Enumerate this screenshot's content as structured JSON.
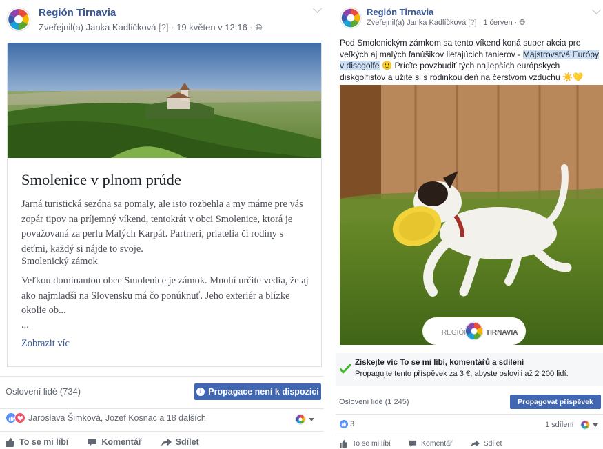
{
  "post1": {
    "page_name": "Región Tirnavia",
    "meta": {
      "author": "Zveřejnil(a) Janka Kadlíčková",
      "qmark": "[?]",
      "date": "· 19 květen v 12:16 ·"
    },
    "card": {
      "title": "Smolenice v plnom prúde",
      "paragraph1": "Jarná turistická sezóna sa pomaly, ale isto rozbehla a my máme pre vás zopár tipov na príjemný víkend, tentokrát v obci Smolenice, ktorá je považovaná za perlu Malých Karpát. Partneri, priatelia či rodiny s deťmi, každý si nájde to svoje.",
      "subheading": "Smolenický zámok",
      "paragraph2": "Veľkou dominantou obce Smolenice je zámok. Mnohí určite vedia, že aj ako najmladší na Slovensku má čo ponúknuť. Jeho exteriér a blízke okolie ob...",
      "ellipsis": "...",
      "more_link": "Zobrazit víc"
    },
    "reach": "Oslovení lidé (734)",
    "promote_unavailable": "Propagace není k dispozici",
    "reactions_names": "Jaroslava Šimková, Jozef Kosnac a 18 dalších",
    "actions": {
      "like": "To se mi líbí",
      "comment": "Komentář",
      "share": "Sdílet"
    }
  },
  "post2": {
    "page_name": "Región Tirnavia",
    "meta": {
      "author": "Zveřejnil(a) Janka Kadlíčková",
      "qmark": "[?]",
      "date": "· 1 červen ·"
    },
    "text": {
      "part1": "Pod Smolenickým zámkom sa tento víkend koná super akcia pre veľkých aj malých fanúšikov lietajúcich tanierov - ",
      "highlight": "Majstrovstvá Európy v discgolfe",
      "part2": " 🙂 Príďte povzbudiť tých najlepších európskych diskgolfistov a užite si s rodinkou deň na čerstvom vzduchu ☀️💛"
    },
    "photo_brand_left": "REGIÓN",
    "photo_brand_right": "TIRNAVIA",
    "promo_title": "Získejte víc To se mi líbí, komentářů a sdílení",
    "promo_sub": "Propagujte tento příspěvek za 3 €, abyste oslovili až 2 200 lidí.",
    "reach": "Oslovení lidé (1 245)",
    "promote_button": "Propagovat příspěvek",
    "likes_count": "3",
    "shares": "1 sdílení",
    "actions": {
      "like": "To se mi líbí",
      "comment": "Komentář",
      "share": "Sdílet"
    }
  },
  "colors": {
    "link": "#365899",
    "button": "#4267b2",
    "like": "#5890ff",
    "love": "#f25268",
    "highlight": "#cce0f5",
    "check": "#42b72a"
  }
}
